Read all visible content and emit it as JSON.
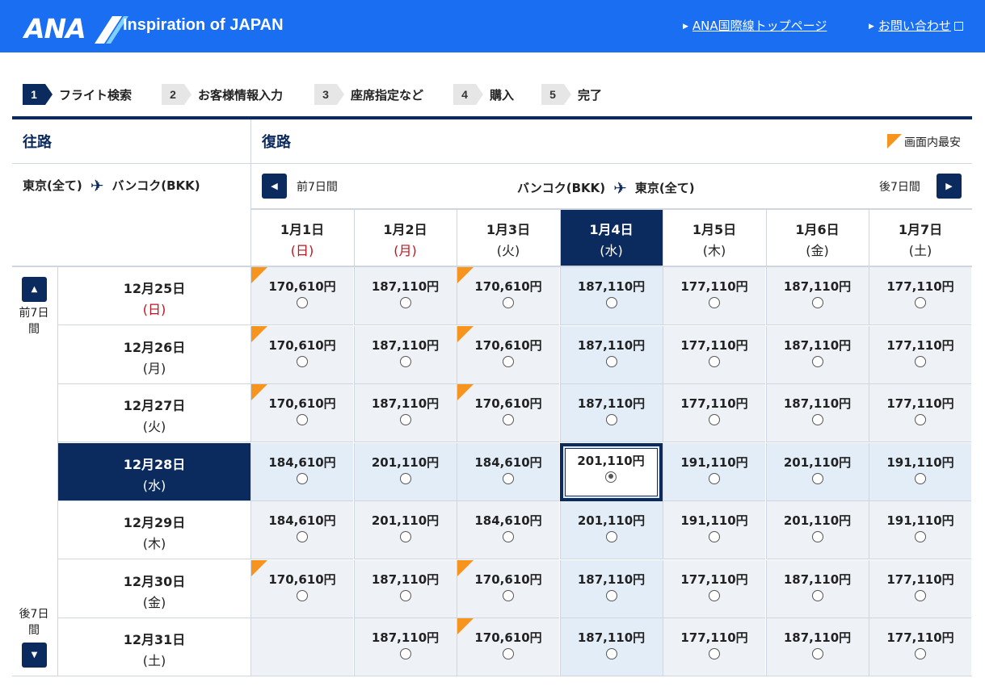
{
  "header": {
    "logo_text": "ANA",
    "tagline": "Inspiration of JAPAN",
    "link_top": "ANA国際線トップページ",
    "link_contact": "お問い合わせ",
    "bg_color": "#1a6ef2"
  },
  "steps": [
    {
      "num": "1",
      "label": "フライト検索",
      "active": true
    },
    {
      "num": "2",
      "label": "お客様情報入力",
      "active": false
    },
    {
      "num": "3",
      "label": "座席指定など",
      "active": false
    },
    {
      "num": "4",
      "label": "購入",
      "active": false
    },
    {
      "num": "5",
      "label": "完了",
      "active": false
    }
  ],
  "outbound": {
    "title": "往路",
    "from": "東京(全て)",
    "to": "バンコク(BKK)",
    "prev_label": "前7日間",
    "next_label": "後7日間",
    "dates": [
      {
        "date": "12月25日",
        "dow": "(日)",
        "sunday": true
      },
      {
        "date": "12月26日",
        "dow": "(月)",
        "sunday": false
      },
      {
        "date": "12月27日",
        "dow": "(火)",
        "sunday": false
      },
      {
        "date": "12月28日",
        "dow": "(水)",
        "sunday": false,
        "selected": true
      },
      {
        "date": "12月29日",
        "dow": "(木)",
        "sunday": false
      },
      {
        "date": "12月30日",
        "dow": "(金)",
        "sunday": false
      },
      {
        "date": "12月31日",
        "dow": "(土)",
        "sunday": false
      }
    ]
  },
  "return": {
    "title": "復路",
    "from": "バンコク(BKK)",
    "to": "東京(全て)",
    "prev_label": "前7日間",
    "next_label": "後7日間",
    "cheapest_legend": "画面内最安",
    "dates": [
      {
        "date": "1月1日",
        "dow": "(日)",
        "sunday": true
      },
      {
        "date": "1月2日",
        "dow": "(月)",
        "sunday": true
      },
      {
        "date": "1月3日",
        "dow": "(火)",
        "sunday": false
      },
      {
        "date": "1月4日",
        "dow": "(水)",
        "sunday": false,
        "selected": true
      },
      {
        "date": "1月5日",
        "dow": "(木)",
        "sunday": false
      },
      {
        "date": "1月6日",
        "dow": "(金)",
        "sunday": false
      },
      {
        "date": "1月7日",
        "dow": "(土)",
        "sunday": false
      }
    ]
  },
  "fares": [
    [
      "170,610円",
      "187,110円",
      "170,610円",
      "187,110円",
      "177,110円",
      "187,110円",
      "177,110円"
    ],
    [
      "170,610円",
      "187,110円",
      "170,610円",
      "187,110円",
      "177,110円",
      "187,110円",
      "177,110円"
    ],
    [
      "170,610円",
      "187,110円",
      "170,610円",
      "187,110円",
      "177,110円",
      "187,110円",
      "177,110円"
    ],
    [
      "184,610円",
      "201,110円",
      "184,610円",
      "201,110円",
      "191,110円",
      "201,110円",
      "191,110円"
    ],
    [
      "184,610円",
      "201,110円",
      "184,610円",
      "201,110円",
      "191,110円",
      "201,110円",
      "191,110円"
    ],
    [
      "170,610円",
      "187,110円",
      "170,610円",
      "187,110円",
      "177,110円",
      "187,110円",
      "177,110円"
    ],
    [
      "",
      "187,110円",
      "170,610円",
      "187,110円",
      "177,110円",
      "187,110円",
      "177,110円"
    ]
  ],
  "cheapest_cells": [
    [
      0,
      0
    ],
    [
      0,
      2
    ],
    [
      1,
      0
    ],
    [
      1,
      2
    ],
    [
      2,
      0
    ],
    [
      2,
      2
    ],
    [
      5,
      0
    ],
    [
      5,
      2
    ],
    [
      6,
      2
    ]
  ],
  "selected_cell": [
    3,
    3
  ],
  "colors": {
    "navy": "#0b2a5e",
    "cheapest": "#f7941d",
    "sunday": "#c0121c"
  }
}
